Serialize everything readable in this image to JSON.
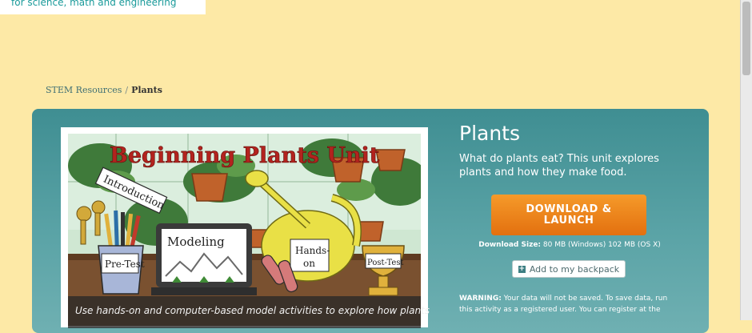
{
  "header": {
    "tagline": "for science, math and engineering"
  },
  "breadcrumb": {
    "root": "STEM Resources",
    "separator": "/",
    "current": "Plants"
  },
  "activity": {
    "title": "Plants",
    "subtitle": "What do plants eat? This unit explores plants and how they make food.",
    "download_label_line1": "DOWNLOAD &",
    "download_label_line2": "LAUNCH",
    "download_size_label": "Download Size:",
    "download_size_value": "80 MB (Windows) 102 MB (OS X)",
    "backpack_label": "Add to my backpack",
    "warning_label": "WARNING:",
    "warning_text": "Your data will not be saved. To save data, run this activity as a registered user. You can register at the"
  },
  "image": {
    "banner_text": "Beginning Plants Unit",
    "tag_introduction": "Introduction",
    "tag_pretest": "Pre-Test",
    "tag_modeling": "Modeling",
    "tag_handson_1": "Hands-",
    "tag_handson_2": "on",
    "tag_posttest": "Post-Test",
    "caption": "Use hands-on and computer-based model activities to explore how plants"
  },
  "colors": {
    "page_bg": "#fde9a6",
    "panel_teal": "#3f8e92",
    "download_orange": "#e3700f"
  }
}
